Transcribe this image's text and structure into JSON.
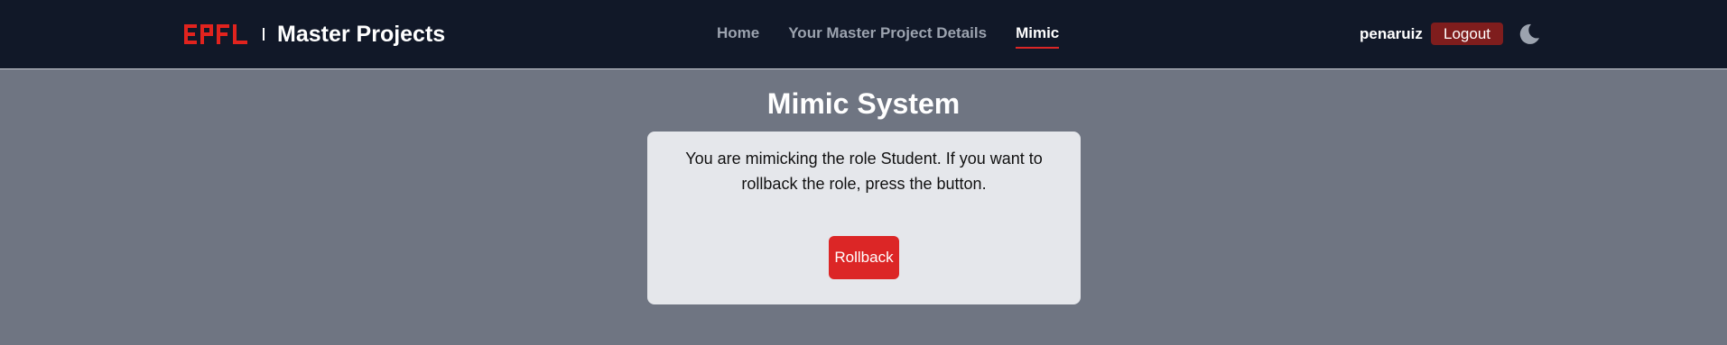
{
  "brand": {
    "logo_text": "EPFL",
    "title": "Master Projects"
  },
  "nav": {
    "links": [
      {
        "label": "Home"
      },
      {
        "label": "Your Master Project Details"
      },
      {
        "label": "Mimic",
        "active": true
      }
    ]
  },
  "user": {
    "name": "penaruiz",
    "logout_label": "Logout",
    "theme_icon": "moon-icon"
  },
  "page": {
    "title": "Mimic System",
    "message": "You are mimicking the role Student. If you want to rollback the role, press the button.",
    "rollback_label": "Rollback"
  },
  "colors": {
    "navbar_bg": "#111828",
    "page_bg": "#6f7582",
    "card_bg": "#e5e7eb",
    "accent_red": "#dc2626",
    "logout_bg": "#7f1d1d"
  }
}
